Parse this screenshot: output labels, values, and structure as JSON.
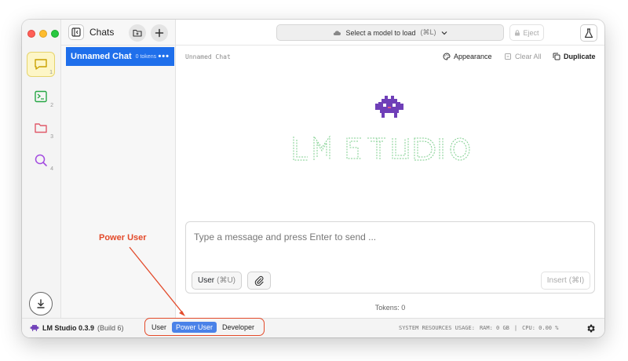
{
  "sidebar": {
    "items": [
      {
        "num": "1",
        "icon": "chat-bubble-icon"
      },
      {
        "num": "2",
        "icon": "terminal-icon"
      },
      {
        "num": "3",
        "icon": "folder-icon"
      },
      {
        "num": "4",
        "icon": "search-icon"
      }
    ]
  },
  "chats": {
    "title": "Chats",
    "items": [
      {
        "name": "Unnamed Chat",
        "tokens": "0 tokens",
        "menu": "•••"
      }
    ]
  },
  "topbar": {
    "model_select": "Select a model to load",
    "model_shortcut": "(⌘L)",
    "eject": "Eject"
  },
  "subbar": {
    "chat_title": "Unnamed Chat",
    "appearance": "Appearance",
    "clear_all": "Clear All",
    "duplicate": "Duplicate"
  },
  "composer": {
    "placeholder": "Type a message and press Enter to send ...",
    "role_button": "User",
    "role_shortcut": "(⌘U)",
    "insert_button": "Insert",
    "insert_shortcut": "(⌘I)"
  },
  "tokens_label": "Tokens: 0",
  "statusbar": {
    "app_name": "LM Studio 0.3.9",
    "build": "(Build 6)",
    "modes": [
      "User",
      "Power User",
      "Developer"
    ],
    "selected_mode": "Power User",
    "system_label": "SYSTEM RESOURCES USAGE:",
    "ram": "RAM: 0 GB",
    "separator": "|",
    "cpu": "CPU: 0.00 %"
  },
  "annotation": {
    "label": "Power User",
    "color": "#e34a2a"
  },
  "colors": {
    "accent": "#1f6feb",
    "mode_selected": "#4a82e8",
    "ascii_green": "#7fcf8f",
    "mascot_purple": "#6f3fb8"
  }
}
